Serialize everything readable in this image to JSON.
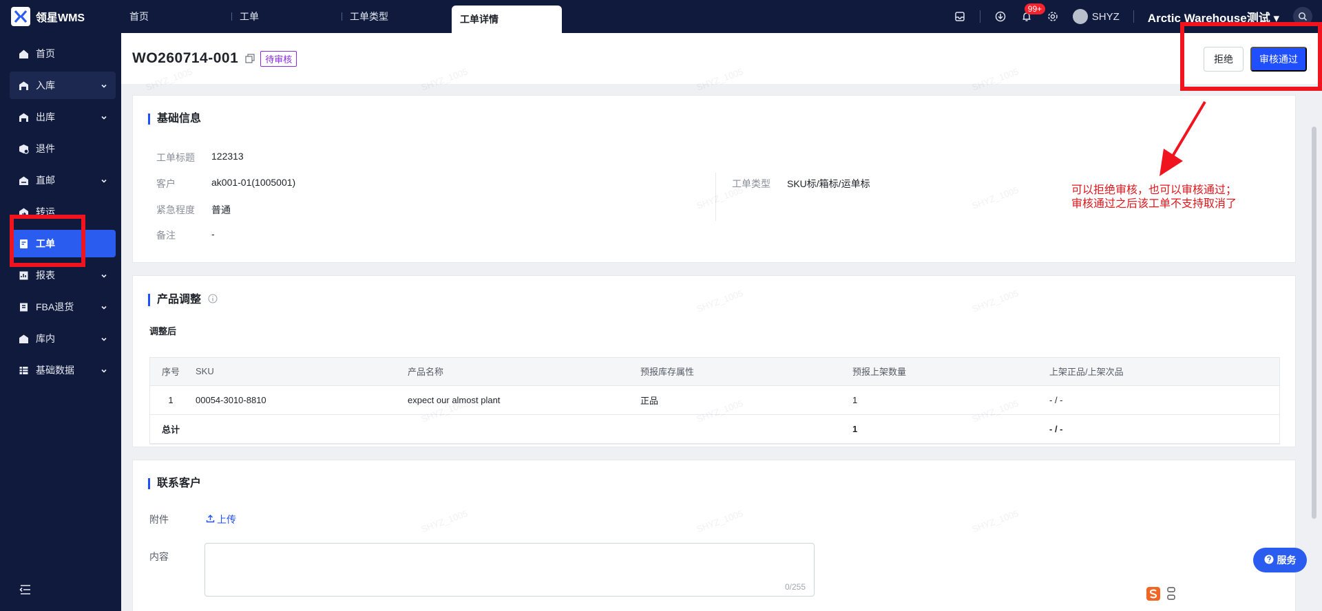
{
  "brand": {
    "name": "领星WMS"
  },
  "tabs": [
    {
      "label": "首页"
    },
    {
      "label": "工单"
    },
    {
      "label": "工单类型"
    },
    {
      "label": "工单详情"
    }
  ],
  "topbar": {
    "notification_count": "99+",
    "username": "SHYZ",
    "warehouse": "Arctic Warehouse测试"
  },
  "sidebar": {
    "items": [
      {
        "label": "首页"
      },
      {
        "label": "入库"
      },
      {
        "label": "出库"
      },
      {
        "label": "退件"
      },
      {
        "label": "直邮"
      },
      {
        "label": "转运"
      },
      {
        "label": "工单"
      },
      {
        "label": "报表"
      },
      {
        "label": "FBA退货"
      },
      {
        "label": "库内"
      },
      {
        "label": "基础数据"
      }
    ]
  },
  "header": {
    "work_order_no": "WO260714-001",
    "status": "待审核",
    "reject_label": "拒绝",
    "approve_label": "审核通过"
  },
  "basic_info": {
    "title": "基础信息",
    "fields": [
      {
        "label": "工单标题",
        "value": "122313"
      },
      {
        "label": "客户",
        "value": "ak001-01(1005001)"
      },
      {
        "label": "紧急程度",
        "value": "普通"
      },
      {
        "label": "备注",
        "value": "-"
      },
      {
        "label": "工单类型",
        "value": "SKU标/箱标/运单标"
      }
    ]
  },
  "product_adjust": {
    "title": "产品调整",
    "subtitle": "调整后",
    "columns": [
      "序号",
      "SKU",
      "产品名称",
      "预报库存属性",
      "预报上架数量",
      "上架正品/上架次品"
    ],
    "rows": [
      {
        "no": "1",
        "sku": "00054-3010-8810",
        "name": "expect our almost plant",
        "attr": "正品",
        "qty": "1",
        "result": "- / -"
      }
    ],
    "total": {
      "label": "总计",
      "qty": "1",
      "result": "- / -"
    }
  },
  "contact": {
    "title": "联系客户",
    "attachment_label": "附件",
    "upload_label": "上传",
    "content_label": "内容",
    "counter": "0/255"
  },
  "annotation": {
    "line1": "可以拒绝审核，也可以审核通过；",
    "line2": "审核通过之后该工单不支持取消了"
  },
  "service_label": "服务",
  "watermark": "SHYZ_1005"
}
